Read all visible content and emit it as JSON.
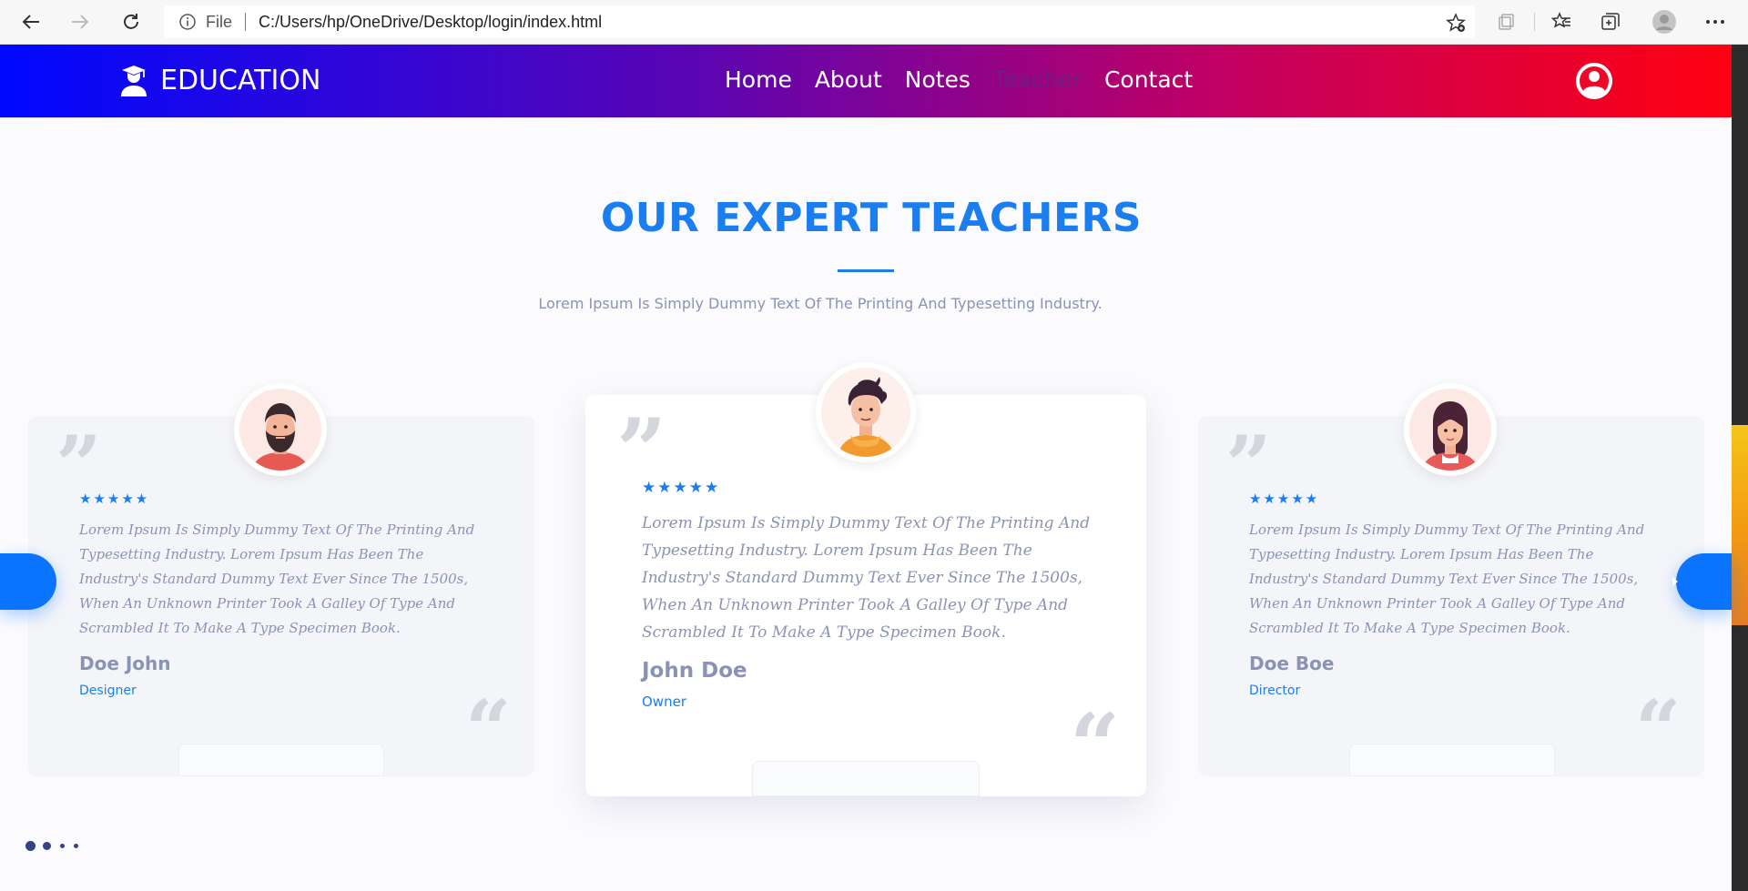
{
  "browser": {
    "scheme_label": "File",
    "url": "C:/Users/hp/OneDrive/Desktop/login/index.html",
    "icons": [
      "back-arrow-icon",
      "forward-arrow-icon",
      "refresh-icon",
      "info-icon",
      "add-favorite-icon",
      "extensions-icon",
      "favorites-icon",
      "collections-icon",
      "profile-icon",
      "more-icon"
    ]
  },
  "navbar": {
    "brand": "EDUCATION",
    "menu": [
      {
        "label": "Home"
      },
      {
        "label": "About"
      },
      {
        "label": "Notes"
      },
      {
        "label": "Teacher"
      },
      {
        "label": "Contact"
      }
    ],
    "active_item": "Teacher",
    "gradient": [
      "#0008ff",
      "#5a05b3",
      "#c00064",
      "#ff0010"
    ]
  },
  "section": {
    "title": "OUR EXPERT TEACHERS",
    "subtitle": "Lorem Ipsum Is Simply Dummy Text Of The Printing And Typesetting Industry."
  },
  "teachers": [
    {
      "name": "Doe John",
      "role": "Designer",
      "rating": 5,
      "stars": "★★★★★",
      "text": "Lorem Ipsum Is Simply Dummy Text Of The Printing And Typesetting Industry. Lorem Ipsum Has Been The Industry's Standard Dummy Text Ever Since The 1500s, When An Unknown Printer Took A Galley Of Type And Scrambled It To Make A Type Specimen Book.",
      "avatar": "bearded-man-avatar"
    },
    {
      "name": "John Doe",
      "role": "Owner",
      "rating": 5,
      "stars": "★★★★★",
      "text": "Lorem Ipsum Is Simply Dummy Text Of The Printing And Typesetting Industry. Lorem Ipsum Has Been The Industry's Standard Dummy Text Ever Since The 1500s, When An Unknown Printer Took A Galley Of Type And Scrambled It To Make A Type Specimen Book.",
      "avatar": "young-man-avatar"
    },
    {
      "name": "Doe Boe",
      "role": "Director",
      "rating": 5,
      "stars": "★★★★★",
      "text": "Lorem Ipsum Is Simply Dummy Text Of The Printing And Typesetting Industry. Lorem Ipsum Has Been The Industry's Standard Dummy Text Ever Since The 1500s, When An Unknown Printer Took A Galley Of Type And Scrambled It To Make A Type Specimen Book.",
      "avatar": "woman-avatar"
    }
  ],
  "carousel": {
    "pages": 4,
    "active_page": 1,
    "accent_color": "#0b74ff"
  },
  "colors": {
    "accent": "#1a7ef0",
    "muted_text": "#8a93b5",
    "dots": "#33428a"
  }
}
